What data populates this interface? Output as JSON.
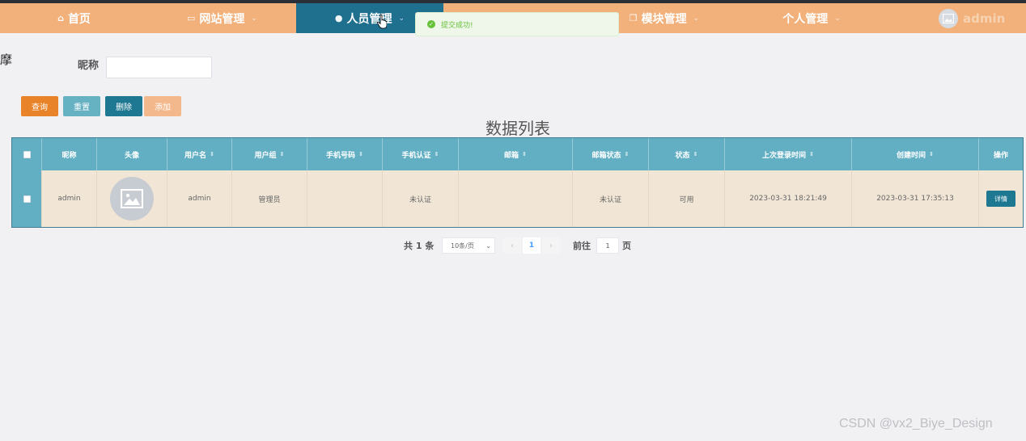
{
  "nav": {
    "items": [
      {
        "label": "首页",
        "icon": "home-icon"
      },
      {
        "label": "网站管理",
        "icon": "monitor-icon"
      },
      {
        "label": "人员管理",
        "icon": "user-icon"
      },
      {
        "label": "模块管理",
        "icon": "module-icon"
      },
      {
        "label": "个人管理",
        "icon": ""
      }
    ],
    "active": "人员管理",
    "user": "admin"
  },
  "toast": {
    "message": "提交成功!",
    "type": "success"
  },
  "left_glyph": "摩",
  "search": {
    "label": "昵称",
    "value": "",
    "placeholder": ""
  },
  "buttons": {
    "query": "查询",
    "reset": "重置",
    "delete": "删除",
    "add": "添加"
  },
  "table": {
    "title": "数据列表",
    "columns": [
      "昵称",
      "头像",
      "用户名",
      "用户组",
      "手机号码",
      "手机认证",
      "邮箱",
      "邮箱状态",
      "状态",
      "上次登录时间",
      "创建时间",
      "操作"
    ],
    "rows": [
      {
        "nickname": "admin",
        "avatar": "image-placeholder-icon",
        "username": "admin",
        "group": "管理员",
        "phone": "",
        "phone_verify": "未认证",
        "email": "",
        "email_status": "未认证",
        "status": "可用",
        "last_login": "2023-03-31 18:21:49",
        "created": "2023-03-31 17:35:13",
        "action": "详情"
      }
    ]
  },
  "pagination": {
    "total": "共 1 条",
    "page_size": "10条/页",
    "current_page": "1",
    "goto_label": "前往",
    "goto_value": "1",
    "page_label": "页"
  },
  "watermark": "CSDN @vx2_Biye_Design",
  "colors": {
    "nav_bg": "#f2b07a",
    "nav_active": "#1f6f8f",
    "table_header": "#62afc4",
    "row_bg": "#f1e5d5",
    "query": "#e8832a",
    "reset": "#66b1c2",
    "delete": "#1f7891",
    "add": "#f3b98c"
  }
}
